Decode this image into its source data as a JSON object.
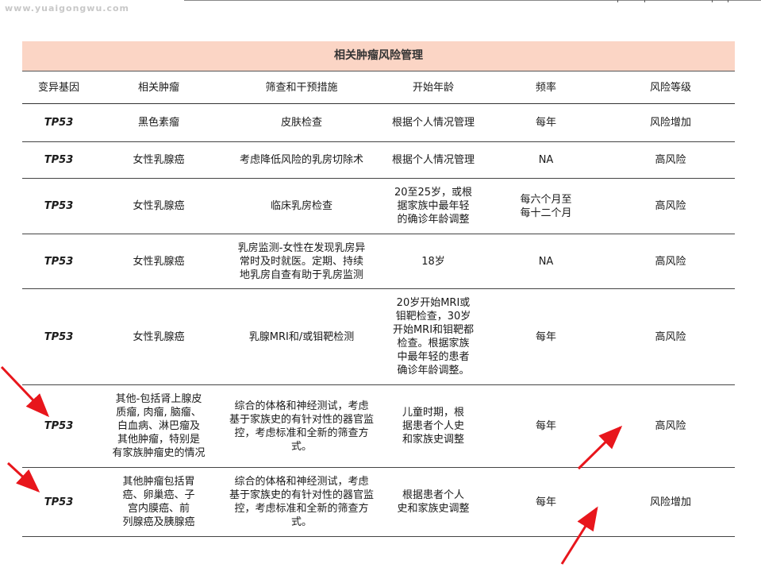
{
  "watermark": "www.yuaigongwu.com",
  "table": {
    "title": "相关肿瘤风险管理",
    "headers": [
      "变异基因",
      "相关肿瘤",
      "筛查和干预措施",
      "开始年龄",
      "频率",
      "风险等级"
    ],
    "rows": [
      [
        "TP53",
        "黑色素瘤",
        "皮肤检查",
        "根据个人情况管理",
        "每年",
        "风险增加"
      ],
      [
        "TP53",
        "女性乳腺癌",
        "考虑降低风险的乳房切除术",
        "根据个人情况管理",
        "NA",
        "高风险"
      ],
      [
        "TP53",
        "女性乳腺癌",
        "临床乳房检查",
        "20至25岁，或根\n据家族中最年轻\n的确诊年龄调整",
        "每六个月至\n每十二个月",
        "高风险"
      ],
      [
        "TP53",
        "女性乳腺癌",
        "乳房监测-女性在发现乳房异\n常时及时就医。定期、持续\n地乳房自查有助于乳房监测",
        "18岁",
        "NA",
        "高风险"
      ],
      [
        "TP53",
        "女性乳腺癌",
        "乳腺MRI和/或钼靶检测",
        "20岁开始MRI或\n钼靶检查，30岁\n开始MRI和钼靶都\n检查。根据家族\n中最年轻的患者\n确诊年龄调整。",
        "每年",
        "高风险"
      ],
      [
        "TP53",
        "其他-包括肾上腺皮\n质瘤, 肉瘤, 脑瘤、\n白血病、淋巴瘤及\n其他肿瘤，特别是\n有家族肿瘤史的情况",
        "综合的体格和神经测试，考虑\n基于家族史的有针对性的器官监\n控，考虑标准和全新的筛查方式。",
        "儿童时期，根\n据患者个人史\n和家族史调整",
        "每年",
        "高风险"
      ],
      [
        "TP53",
        "其他肿瘤包括胃\n癌、卵巢癌、子\n宫内膜癌、前\n列腺癌及胰腺癌",
        "综合的体格和神经测试，考虑\n基于家族史的有针对性的器官监\n控，考虑标准和全新的筛查方式。",
        "根据患者个人\n史和家族史调整",
        "每年",
        "风险增加"
      ]
    ]
  },
  "colors": {
    "title_bg": "#fbd5c5",
    "arrow": "#e8161c"
  },
  "annotations": [
    "red-arrow",
    "red-arrow",
    "red-arrow",
    "red-arrow"
  ]
}
